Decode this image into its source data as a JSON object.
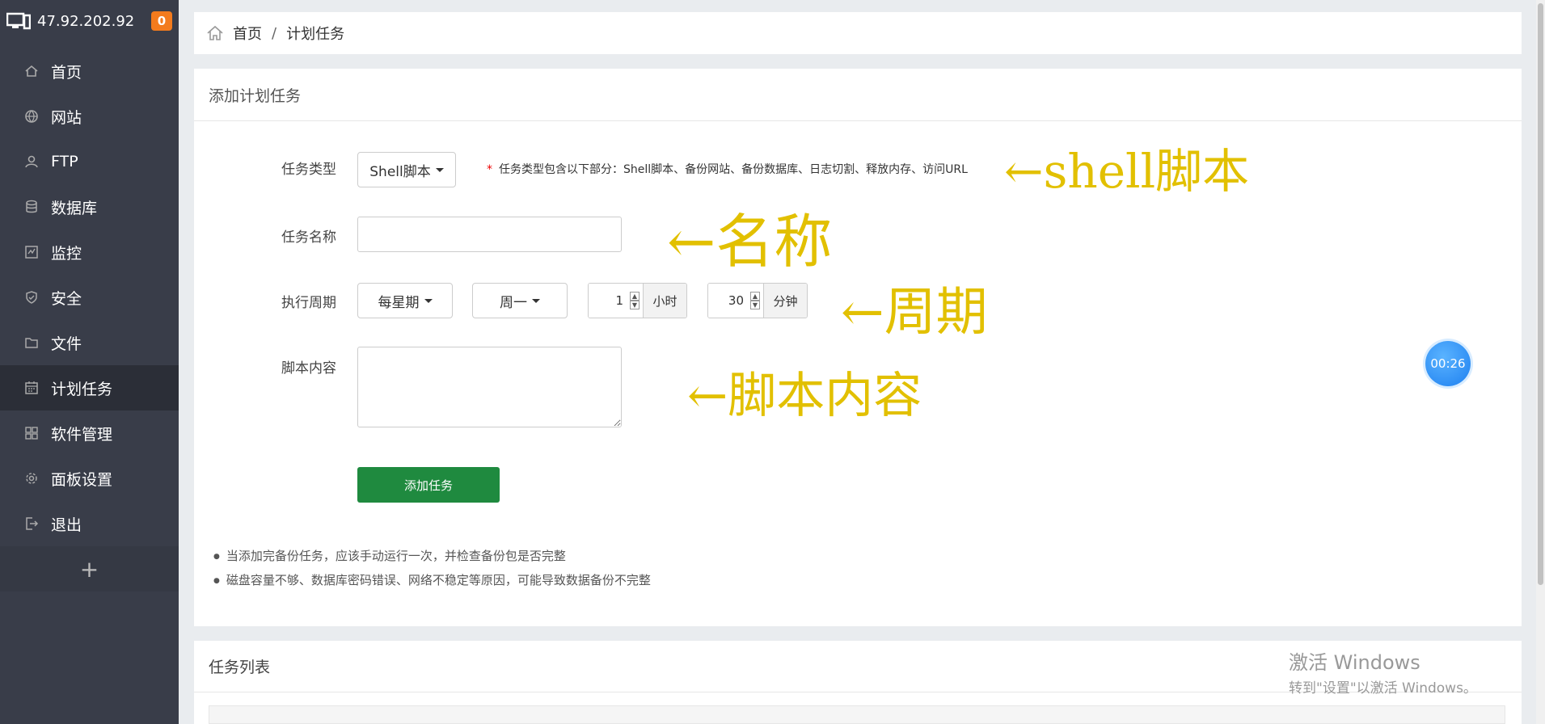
{
  "sidebar": {
    "server_ip": "47.92.202.92",
    "badge_count": "0",
    "items": [
      {
        "label": "首页",
        "icon": "home-icon"
      },
      {
        "label": "网站",
        "icon": "globe-icon"
      },
      {
        "label": "FTP",
        "icon": "ftp-icon"
      },
      {
        "label": "数据库",
        "icon": "database-icon"
      },
      {
        "label": "监控",
        "icon": "monitor-icon"
      },
      {
        "label": "安全",
        "icon": "shield-icon"
      },
      {
        "label": "文件",
        "icon": "folder-icon"
      },
      {
        "label": "计划任务",
        "icon": "calendar-icon"
      },
      {
        "label": "软件管理",
        "icon": "apps-icon"
      },
      {
        "label": "面板设置",
        "icon": "gear-icon"
      },
      {
        "label": "退出",
        "icon": "logout-icon"
      }
    ],
    "active_item": "计划任务",
    "add_label": "+"
  },
  "breadcrumb": {
    "home": "首页",
    "separator": "/",
    "current": "计划任务"
  },
  "form": {
    "title": "添加计划任务",
    "task_type_label": "任务类型",
    "task_type_value": "Shell脚本",
    "task_type_hint_star": "*",
    "task_type_hint": "任务类型包含以下部分：Shell脚本、备份网站、备份数据库、日志切割、释放内存、访问URL",
    "task_name_label": "任务名称",
    "task_name_value": "",
    "cycle_label": "执行周期",
    "cycle_type": "每星期",
    "weekday": "周一",
    "hour_value": "1",
    "hour_unit": "小时",
    "minute_value": "30",
    "minute_unit": "分钟",
    "script_label": "脚本内容",
    "script_value": "",
    "submit_label": "添加任务",
    "notes": [
      "当添加完备份任务，应该手动运行一次，并检查备份包是否完整",
      "磁盘容量不够、数据库密码错误、网络不稳定等原因，可能导致数据备份不完整"
    ]
  },
  "annotations": {
    "shell": "←shell脚本",
    "name": "←名称",
    "cycle": "←周期",
    "script": "←脚本内容"
  },
  "task_list": {
    "title": "任务列表"
  },
  "timer": "00:26",
  "watermark": {
    "line1": "激活 Windows",
    "line2": "转到\"设置\"以激活 Windows。"
  },
  "colors": {
    "sidebar_bg": "#393d49",
    "submit_green": "#1f8a3f",
    "annotation_yellow": "#e2c000",
    "badge_orange": "#f37b1d"
  }
}
